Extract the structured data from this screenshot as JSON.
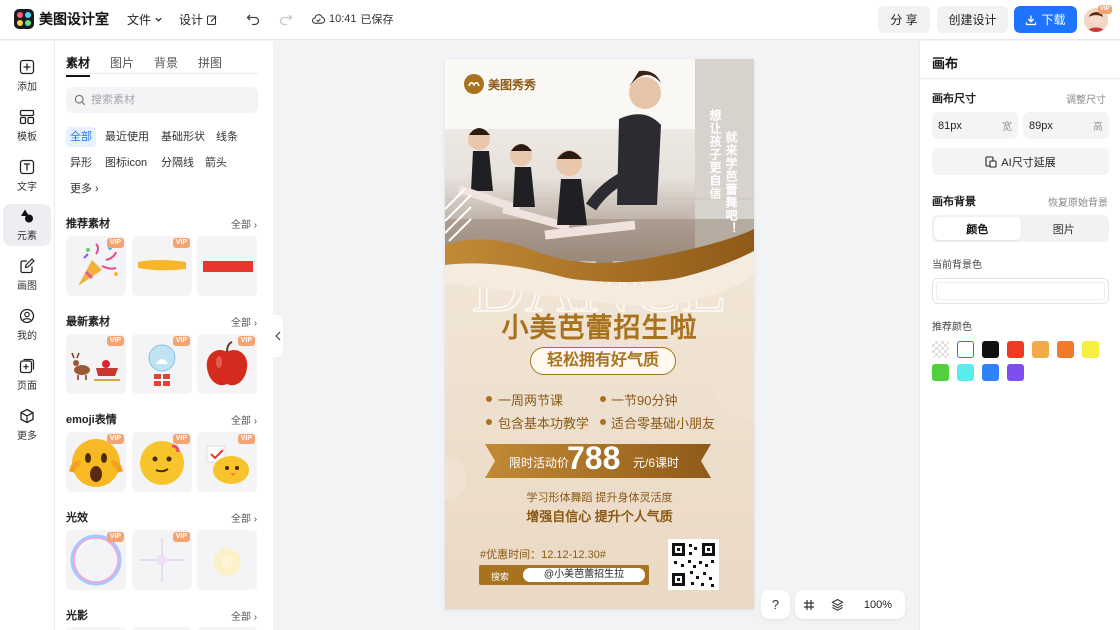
{
  "app": {
    "name": "美图设计室"
  },
  "topbar": {
    "file_menu": "文件",
    "design_menu": "设计",
    "save_time": "10:41",
    "save_status": "已保存",
    "share": "分 享",
    "create_design": "创建设计",
    "download": "下载",
    "avatar_badge": "VIP"
  },
  "rail": [
    {
      "label": "添加",
      "icon": "plus-square-icon"
    },
    {
      "label": "模板",
      "icon": "template-icon"
    },
    {
      "label": "文字",
      "icon": "text-icon"
    },
    {
      "label": "元素",
      "icon": "shapes-icon"
    },
    {
      "label": "画图",
      "icon": "pen-icon"
    },
    {
      "label": "我的",
      "icon": "user-icon"
    },
    {
      "label": "页面",
      "icon": "page-add-icon"
    },
    {
      "label": "更多",
      "icon": "cube-icon"
    }
  ],
  "left_panel": {
    "tabs": [
      "素材",
      "图片",
      "背景",
      "拼图"
    ],
    "search_placeholder": "搜索素材",
    "chips_row1": [
      "全部",
      "最近使用",
      "基础形状",
      "线条"
    ],
    "chips_row2": [
      "异形",
      "图标icon",
      "分隔线",
      "箭头"
    ],
    "more_chip": "更多",
    "all_label": "全部",
    "vip_label": "VIP",
    "sections": [
      {
        "title": "推荐素材",
        "items": [
          "party-popper",
          "yellow-brush-stroke",
          "red-bar"
        ]
      },
      {
        "title": "最新素材",
        "items": [
          "reindeer-sleigh",
          "snow-globe-gift",
          "red-apple"
        ]
      },
      {
        "title": "emoji表情",
        "items": [
          "shocked-emoji",
          "thinking-emoji",
          "chick-emoji"
        ]
      },
      {
        "title": "光效",
        "items": [
          "bubble-ring",
          "sparkle-star",
          "soft-glow"
        ]
      },
      {
        "title": "光影",
        "items": []
      }
    ]
  },
  "poster": {
    "brand": "美图秀秀",
    "vertical_text_1": "就来学芭蕾舞吧！",
    "vertical_text_2": "想让孩子更自信",
    "watermark_word": "DANCE",
    "headline": "小美芭蕾招生啦",
    "subheadline": "轻松拥有好气质",
    "bullets": [
      "一周两节课",
      "一节90分钟",
      "包含基本功教学",
      "适合零基础小朋友"
    ],
    "price_prefix": "限时活动价",
    "price": "788",
    "price_suffix": "元/6课时",
    "line1": "学习形体舞蹈 提升身体灵活度",
    "line2": "增强自信心 提升个人气质",
    "promo_time": "#优惠时间：12.12-12.30#",
    "search_label": "搜索",
    "account": "@小美芭蕾招生拉"
  },
  "right_panel": {
    "title": "画布",
    "size_label": "画布尺寸",
    "resize_link": "调整尺寸",
    "width_value": "81px",
    "width_unit": "宽",
    "height_value": "89px",
    "height_unit": "高",
    "ai_extend": "AI尺寸延展",
    "bg_label": "画布背景",
    "restore_bg": "恢复原始背景",
    "tab_color": "颜色",
    "tab_image": "图片",
    "current_bg_label": "当前背景色",
    "recommended_label": "推荐颜色",
    "swatches": [
      "transparent",
      "#ffffff",
      "#111111",
      "#ee3b24",
      "#f3a94a",
      "#f07a2a",
      "#f7ef3f",
      "#52cf3d",
      "#58ecec",
      "#2f82f7",
      "#7e4ff0"
    ]
  },
  "zoom": {
    "help": "?",
    "level": "100%"
  },
  "colors": {
    "accent": "#1f74ff",
    "gold": "#a8731f",
    "vip": "#f5a471"
  }
}
